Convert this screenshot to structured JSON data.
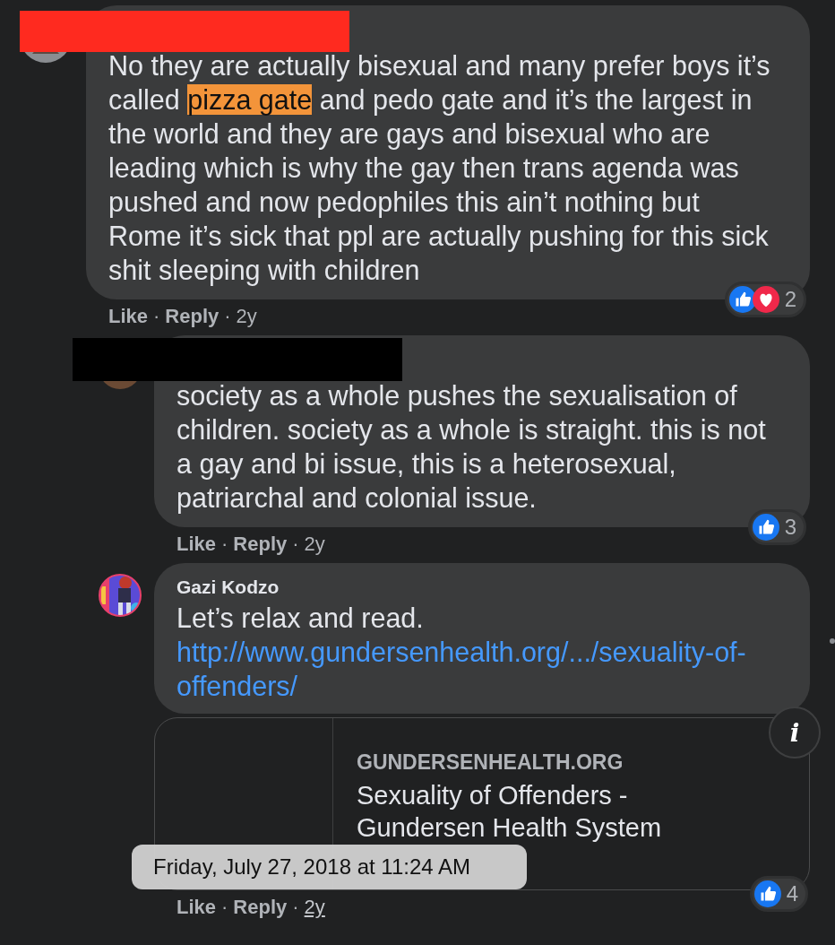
{
  "separator": "·",
  "comment": {
    "redaction": {
      "color": "#ff2a1f"
    },
    "body": [
      {
        "text": "No they are actually bisexual and many prefer boys it’s called ",
        "highlight": false
      },
      {
        "text": "pizza gate",
        "highlight": true
      },
      {
        "text": " and pedo gate and it’s the largest in the world and they are gays and bisexual who are leading which is why the gay then trans agenda was pushed and now pedophiles this ain’t nothing but Rome it’s sick that ppl are actually pushing for this sick shit sleeping with children",
        "highlight": false
      }
    ],
    "reactions": {
      "icons": [
        {
          "kind": "like"
        },
        {
          "kind": "love"
        }
      ],
      "count": "2"
    },
    "actions": [
      {
        "label": "Like",
        "kind": "button"
      },
      {
        "label": "Reply",
        "kind": "button"
      },
      {
        "label": "2y",
        "kind": "time",
        "hovered": false
      }
    ],
    "replies": [
      {
        "redaction": {
          "color": "#000000"
        },
        "body": [
          {
            "text": "society as a whole pushes the sexualisation of children. society as a whole is straight. this is not a gay and bi issue, this is a heterosexual, patriarchal and colonial issue.",
            "highlight": false
          }
        ],
        "reactions": {
          "icons": [
            {
              "kind": "like"
            }
          ],
          "count": "3"
        },
        "actions": [
          {
            "label": "Like",
            "kind": "button"
          },
          {
            "label": "Reply",
            "kind": "button"
          },
          {
            "label": "2y",
            "kind": "time",
            "hovered": false
          }
        ]
      },
      {
        "author": "Gazi Kodzo",
        "avatar": {
          "kind": "picture"
        },
        "body": [
          {
            "text": "Let’s relax and read.",
            "highlight": false
          }
        ],
        "link": "http://www.gundersenhealth.org/.../sexuality-of-offenders/",
        "preview": {
          "domain": "GUNDERSENHEALTH.ORG",
          "title": "Sexuality of Offenders - Gundersen Health System",
          "info": "i"
        },
        "tooltip": "Friday, July 27, 2018 at 11:24 AM",
        "reactions": {
          "icons": [
            {
              "kind": "like"
            }
          ],
          "count": "4"
        },
        "actions": [
          {
            "label": "Like",
            "kind": "button"
          },
          {
            "label": "Reply",
            "kind": "button"
          },
          {
            "label": "2y",
            "kind": "time",
            "hovered": true
          }
        ]
      }
    ]
  }
}
